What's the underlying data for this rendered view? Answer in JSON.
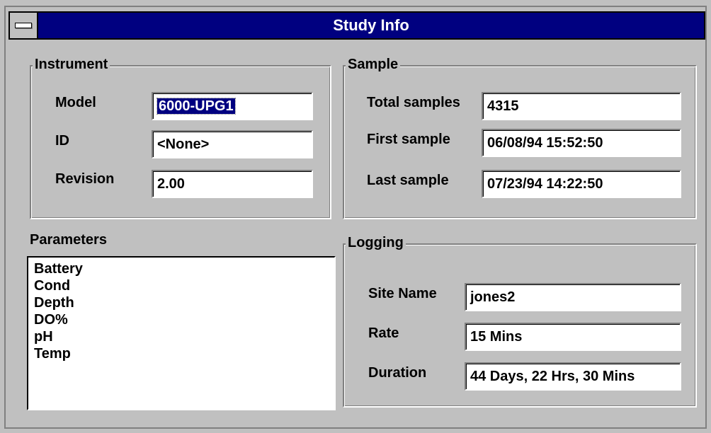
{
  "window": {
    "title": "Study Info"
  },
  "instrument": {
    "group_label": "Instrument",
    "model_label": "Model",
    "model_value": "6000-UPG1",
    "id_label": "ID",
    "id_value": "<None>",
    "revision_label": "Revision",
    "revision_value": "2.00"
  },
  "sample": {
    "group_label": "Sample",
    "total_label": "Total samples",
    "total_value": "4315",
    "first_label": "First sample",
    "first_value": "06/08/94 15:52:50",
    "last_label": "Last sample",
    "last_value": "07/23/94 14:22:50"
  },
  "parameters": {
    "label": "Parameters",
    "items": [
      "Battery",
      "Cond",
      "Depth",
      "DO%",
      "pH",
      "Temp"
    ]
  },
  "logging": {
    "group_label": "Logging",
    "site_label": "Site Name",
    "site_value": "jones2",
    "rate_label": "Rate",
    "rate_value": "15 Mins",
    "duration_label": "Duration",
    "duration_value": "44 Days, 22 Hrs, 30 Mins"
  },
  "icons": {
    "system_menu": "system-menu-icon"
  },
  "colors": {
    "titlebar": "#000080",
    "face": "#c0c0c0",
    "selection": "#000080"
  }
}
